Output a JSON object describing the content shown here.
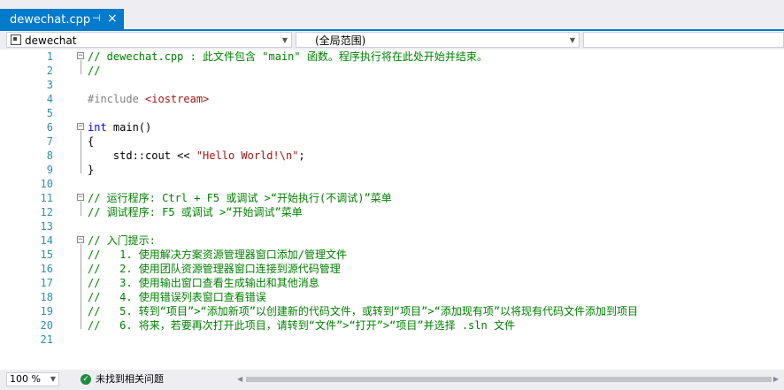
{
  "tab": {
    "title": "dewechat.cpp",
    "pin_glyph": "⊣",
    "close_glyph": "×"
  },
  "nav": {
    "project": "dewechat",
    "scope": "(全局范围)",
    "member": ""
  },
  "lines": [
    {
      "n": "1",
      "parts": [
        {
          "c": "comment",
          "t": "// dewechat.cpp : 此文件包含 \"main\" 函数。程序执行将在此处开始并结束。"
        }
      ]
    },
    {
      "n": "2",
      "parts": [
        {
          "c": "comment",
          "t": "//"
        }
      ]
    },
    {
      "n": "3",
      "parts": []
    },
    {
      "n": "4",
      "parts": [
        {
          "c": "pre",
          "t": "#include "
        },
        {
          "c": "str",
          "t": "<iostream>"
        }
      ]
    },
    {
      "n": "5",
      "parts": []
    },
    {
      "n": "6",
      "parts": [
        {
          "c": "kw",
          "t": "int"
        },
        {
          "c": "txt",
          "t": " main()"
        }
      ]
    },
    {
      "n": "7",
      "parts": [
        {
          "c": "txt",
          "t": "{"
        }
      ]
    },
    {
      "n": "8",
      "parts": [
        {
          "c": "txt",
          "t": "    std::cout << "
        },
        {
          "c": "str",
          "t": "\"Hello World!\\n\""
        },
        {
          "c": "txt",
          "t": ";"
        }
      ]
    },
    {
      "n": "9",
      "parts": [
        {
          "c": "txt",
          "t": "}"
        }
      ]
    },
    {
      "n": "10",
      "parts": []
    },
    {
      "n": "11",
      "parts": [
        {
          "c": "comment",
          "t": "// 运行程序: Ctrl + F5 或调试 >“开始执行(不调试)”菜单"
        }
      ]
    },
    {
      "n": "12",
      "parts": [
        {
          "c": "comment",
          "t": "// 调试程序: F5 或调试 >“开始调试”菜单"
        }
      ]
    },
    {
      "n": "13",
      "parts": []
    },
    {
      "n": "14",
      "parts": [
        {
          "c": "comment",
          "t": "// 入门提示:"
        }
      ]
    },
    {
      "n": "15",
      "parts": [
        {
          "c": "comment",
          "t": "//   1. 使用解决方案资源管理器窗口添加/管理文件"
        }
      ]
    },
    {
      "n": "16",
      "parts": [
        {
          "c": "comment",
          "t": "//   2. 使用团队资源管理器窗口连接到源代码管理"
        }
      ]
    },
    {
      "n": "17",
      "parts": [
        {
          "c": "comment",
          "t": "//   3. 使用输出窗口查看生成输出和其他消息"
        }
      ]
    },
    {
      "n": "18",
      "parts": [
        {
          "c": "comment",
          "t": "//   4. 使用错误列表窗口查看错误"
        }
      ]
    },
    {
      "n": "19",
      "parts": [
        {
          "c": "comment",
          "t": "//   5. 转到“项目”>“添加新项”以创建新的代码文件，或转到“项目”>“添加现有项”以将现有代码文件添加到项目"
        }
      ]
    },
    {
      "n": "20",
      "parts": [
        {
          "c": "comment",
          "t": "//   6. 将来，若要再次打开此项目，请转到“文件”>“打开”>“项目”并选择 .sln 文件"
        }
      ]
    },
    {
      "n": "21",
      "parts": []
    }
  ],
  "status": {
    "zoom": "100 %",
    "issues": "未找到相关问题"
  }
}
